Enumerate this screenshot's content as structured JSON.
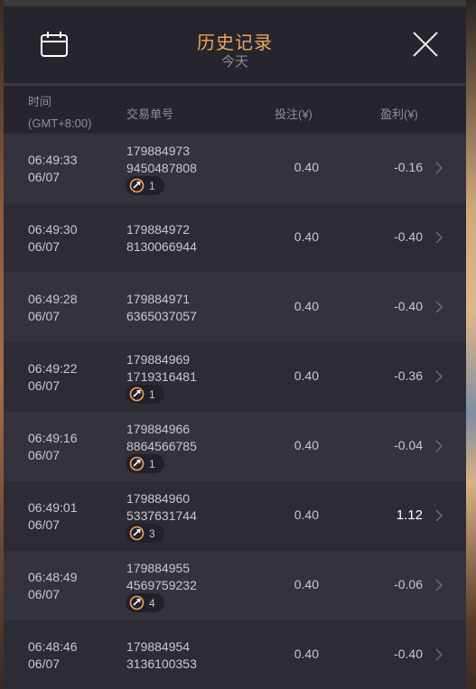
{
  "header": {
    "title": "历史记录",
    "subtitle": "今天",
    "calendar_icon": "calendar-icon",
    "close_icon": "close-icon"
  },
  "columns": {
    "time_line1": "时间",
    "time_line2": "(GMT+8:00)",
    "id": "交易单号",
    "bet": "投注(¥)",
    "profit": "盈利(¥)"
  },
  "colors": {
    "accent": "#f0a35e",
    "panel": "#2b2a33",
    "row_alt": "#34333d",
    "text": "#c9c8cf"
  },
  "rows": [
    {
      "time": "06:49:33",
      "date": "06/07",
      "id_line1": "179884973",
      "id_line2": "9450487808",
      "badge": "1",
      "bet": "0.40",
      "profit": "-0.16",
      "positive": false
    },
    {
      "time": "06:49:30",
      "date": "06/07",
      "id_line1": "179884972",
      "id_line2": "8130066944",
      "badge": "",
      "bet": "0.40",
      "profit": "-0.40",
      "positive": false
    },
    {
      "time": "06:49:28",
      "date": "06/07",
      "id_line1": "179884971",
      "id_line2": "6365037057",
      "badge": "",
      "bet": "0.40",
      "profit": "-0.40",
      "positive": false
    },
    {
      "time": "06:49:22",
      "date": "06/07",
      "id_line1": "179884969",
      "id_line2": "1719316481",
      "badge": "1",
      "bet": "0.40",
      "profit": "-0.36",
      "positive": false
    },
    {
      "time": "06:49:16",
      "date": "06/07",
      "id_line1": "179884966",
      "id_line2": "8864566785",
      "badge": "1",
      "bet": "0.40",
      "profit": "-0.04",
      "positive": false
    },
    {
      "time": "06:49:01",
      "date": "06/07",
      "id_line1": "179884960",
      "id_line2": "5337631744",
      "badge": "3",
      "bet": "0.40",
      "profit": "1.12",
      "positive": true
    },
    {
      "time": "06:48:49",
      "date": "06/07",
      "id_line1": "179884955",
      "id_line2": "4569759232",
      "badge": "4",
      "bet": "0.40",
      "profit": "-0.06",
      "positive": false
    },
    {
      "time": "06:48:46",
      "date": "06/07",
      "id_line1": "179884954",
      "id_line2": "3136100353",
      "badge": "",
      "bet": "0.40",
      "profit": "-0.40",
      "positive": false
    }
  ]
}
